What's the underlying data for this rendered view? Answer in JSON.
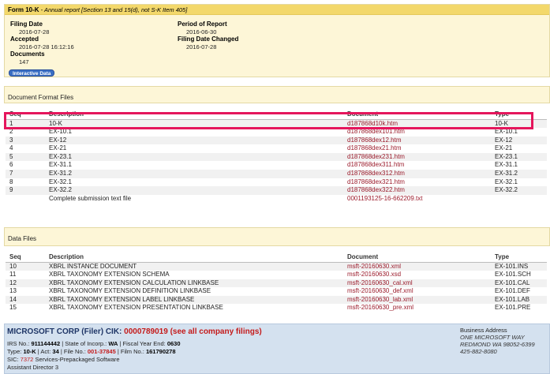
{
  "form_bar": {
    "form": "Form 10-K",
    "desc": " - Annual report [Section 13 and 15(d), not S-K Item 405]"
  },
  "header": {
    "filing_date_label": "Filing Date",
    "filing_date": "2016-07-28",
    "accepted_label": "Accepted",
    "accepted": "2016-07-28 16:12:16",
    "documents_label": "Documents",
    "documents": "147",
    "period_label": "Period of Report",
    "period": "2016-06-30",
    "changed_label": "Filing Date Changed",
    "changed": "2016-07-28",
    "interactive_button": "Interactive Data"
  },
  "doc_files": {
    "title": "Document Format Files",
    "headers": [
      "Seq",
      "Description",
      "Document",
      "Type"
    ],
    "rows": [
      [
        "1",
        "10-K",
        "d187868d10k.htm",
        "10-K"
      ],
      [
        "2",
        "EX-10.1",
        "d187868dex101.htm",
        "EX-10.1"
      ],
      [
        "3",
        "EX-12",
        "d187868dex12.htm",
        "EX-12"
      ],
      [
        "4",
        "EX-21",
        "d187868dex21.htm",
        "EX-21"
      ],
      [
        "5",
        "EX-23.1",
        "d187868dex231.htm",
        "EX-23.1"
      ],
      [
        "6",
        "EX-31.1",
        "d187868dex311.htm",
        "EX-31.1"
      ],
      [
        "7",
        "EX-31.2",
        "d187868dex312.htm",
        "EX-31.2"
      ],
      [
        "8",
        "EX-32.1",
        "d187868dex321.htm",
        "EX-32.1"
      ],
      [
        "9",
        "EX-32.2",
        "d187868dex322.htm",
        "EX-32.2"
      ],
      [
        "",
        "Complete submission text file",
        "0001193125-16-662209.txt",
        ""
      ]
    ]
  },
  "data_files": {
    "title": "Data Files",
    "headers": [
      "Seq",
      "Description",
      "Document",
      "Type"
    ],
    "rows": [
      [
        "10",
        "XBRL INSTANCE DOCUMENT",
        "msft-20160630.xml",
        "EX-101.INS"
      ],
      [
        "11",
        "XBRL TAXONOMY EXTENSION SCHEMA",
        "msft-20160630.xsd",
        "EX-101.SCH"
      ],
      [
        "12",
        "XBRL TAXONOMY EXTENSION CALCULATION LINKBASE",
        "msft-20160630_cal.xml",
        "EX-101.CAL"
      ],
      [
        "13",
        "XBRL TAXONOMY EXTENSION DEFINITION LINKBASE",
        "msft-20160630_def.xml",
        "EX-101.DEF"
      ],
      [
        "14",
        "XBRL TAXONOMY EXTENSION LABEL LINKBASE",
        "msft-20160630_lab.xml",
        "EX-101.LAB"
      ],
      [
        "15",
        "XBRL TAXONOMY EXTENSION PRESENTATION LINKBASE",
        "msft-20160630_pre.xml",
        "EX-101.PRE"
      ]
    ]
  },
  "filer": {
    "name": "MICROSOFT CORP (Filer) CIK: ",
    "cik": "0000789019",
    "see_all": "(see all company filings)",
    "irs_label": "IRS No.: ",
    "irs": "911144442",
    "state_label": " | State of Incorp.: ",
    "state": "WA",
    "fy_label": " | Fiscal Year End: ",
    "fy": "0630",
    "type_label": "Type: ",
    "type": "10-K",
    "act_label": " | Act: ",
    "act": "34",
    "file_label": " | File No.: ",
    "file_no": "001-37845",
    "film_label": " | Film No.: ",
    "film": "161790278",
    "sic_label": "SIC: ",
    "sic": "7372",
    "sic_desc": " Services-Prepackaged Software",
    "office": "Assistant Director 3",
    "biz_label": "Business Address",
    "biz_line1": "ONE MICROSOFT WAY",
    "biz_line2": "REDMOND WA 98052-6399",
    "biz_phone": "425-882-8080"
  },
  "colors": {
    "highlight": "#e5165c",
    "link": "#9b1b2b",
    "formbar": "#f3d86b",
    "filer_bg": "#d4e1ef"
  }
}
